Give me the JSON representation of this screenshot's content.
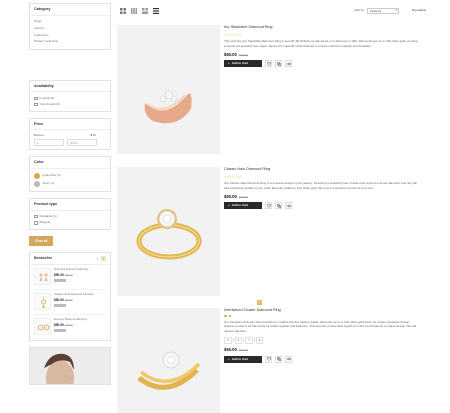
{
  "sidebar": {
    "category": {
      "title": "Category",
      "items": [
        "Rings",
        "Jewelry",
        "Collections",
        "Modern Collection"
      ]
    },
    "availability": {
      "title": "Availability",
      "options": [
        "In stock (6)",
        "Out of stock (2)"
      ]
    },
    "price": {
      "title": "Price",
      "from_label": "$ From",
      "to_label": "$ To",
      "from_placeholder": "0",
      "to_placeholder": "80.00"
    },
    "color": {
      "title": "Color",
      "options": [
        {
          "label": "gold-white (5)",
          "hex": "#d8a93d"
        },
        {
          "label": "silver (1)",
          "hex": "#b9b9b9"
        }
      ]
    },
    "product_type": {
      "title": "Product type",
      "options": [
        "Pendants (1)",
        "Ring (4)"
      ]
    },
    "clear_all": "Clear all",
    "bestseller": {
      "title": "Bestseller",
      "prev": "‹",
      "next": "›",
      "items": [
        {
          "name": "Jhumkha Diamond Earrings",
          "price": "$50.00",
          "old": "$60.00"
        },
        {
          "name": "Antique Gold Diamond Pendant",
          "price": "$50.00",
          "old": "$60.00"
        },
        {
          "name": "Evil-eye Diamond Earrings",
          "price": "$50.00",
          "old": "$60.00"
        }
      ]
    }
  },
  "toolbar": {
    "sort_label": "Sort by",
    "sort_value": "Featured",
    "count": "8 products"
  },
  "products": [
    {
      "name": "Arc Stackable Diamond Ring",
      "stars": "☆☆☆☆☆",
      "description": "This stunning Arc Stackable Diamond Ring is set with 99 brilliant-cut diamonds on a band set in 18kt. Diamonds are set in 14k white gold, creating a simple but beautiful look. Each diamond is carefully hand-selected to ensure maximum sparkle and durability.",
      "price": "$50.00",
      "old_price": "$60.00",
      "cart_label": "Add to Cart"
    },
    {
      "name": "Classic Halo Diamond Ring",
      "stars": "☆☆☆☆☆",
      "description": "Our Classic Halo Diamond Ring is a timeless design in fine jewelry. Featuring a sparkling halo of diamonds around a center diamond, this ring will add a dazzling sparkle to any outfit. Expertly crafted in 14K white gold, this ring is a standout symbol of your love.",
      "price": "$50.00",
      "old_price": "$60.00",
      "cart_label": "Add to Cart"
    },
    {
      "name": "Intertwined Cluster Diamond Ring",
      "stars": "☆☆☆☆☆",
      "description": "Our Intertwined Cluster Diamond Ring is crafted with the highest quality diamonds set in a 14K white gold band. Its unique intertwine design features a total of 18 diamonds for added sparkle and brilliance. This ring has a total carat weight of 0.30 ct and features a unique design that will capture attention.",
      "price": "$50.00",
      "old_price": "$60.00",
      "cart_label": "Add to Cart",
      "sizes": [
        "5",
        "6",
        "7",
        "8"
      ]
    }
  ],
  "badges": {
    "wishlist_count": "0"
  },
  "colors": {
    "accent": "#d4a85a",
    "dark": "#2a2a2a",
    "star": "#e7a83c"
  }
}
